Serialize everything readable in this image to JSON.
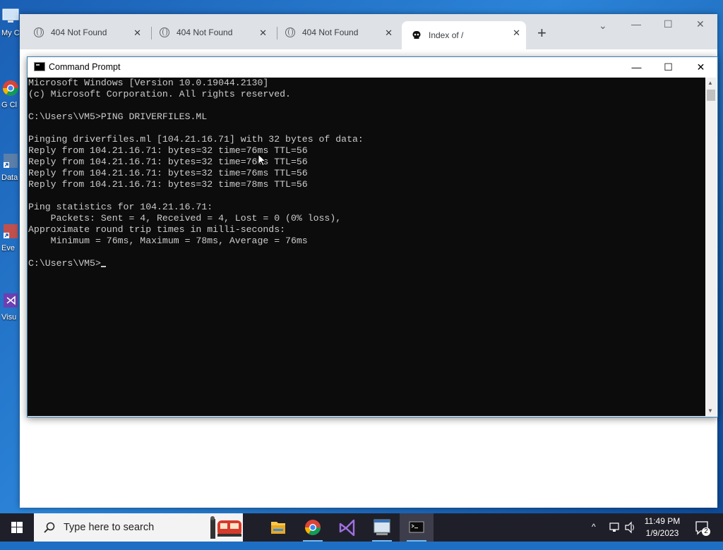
{
  "desktop": {
    "icons": [
      {
        "label": "My C"
      },
      {
        "label": "G Cl"
      },
      {
        "label": "Data"
      },
      {
        "label": "Eve"
      },
      {
        "label": "Visu"
      }
    ]
  },
  "browser": {
    "tabs": [
      {
        "title": "404 Not Found"
      },
      {
        "title": "404 Not Found"
      },
      {
        "title": "404 Not Found"
      },
      {
        "title": "Index of /"
      }
    ],
    "close_glyph": "✕",
    "new_tab_glyph": "+"
  },
  "cmd": {
    "title": "Command Prompt",
    "minimize_glyph": "—",
    "maximize_glyph": "☐",
    "close_glyph": "✕",
    "lines": [
      "Microsoft Windows [Version 10.0.19044.2130]",
      "(c) Microsoft Corporation. All rights reserved.",
      "",
      "C:\\Users\\VM5>PING DRIVERFILES.ML",
      "",
      "Pinging driverfiles.ml [104.21.16.71] with 32 bytes of data:",
      "Reply from 104.21.16.71: bytes=32 time=76ms TTL=56",
      "Reply from 104.21.16.71: bytes=32 time=76ms TTL=56",
      "Reply from 104.21.16.71: bytes=32 time=76ms TTL=56",
      "Reply from 104.21.16.71: bytes=32 time=78ms TTL=56",
      "",
      "Ping statistics for 104.21.16.71:",
      "    Packets: Sent = 4, Received = 4, Lost = 0 (0% loss),",
      "Approximate round trip times in milli-seconds:",
      "    Minimum = 76ms, Maximum = 78ms, Average = 76ms",
      ""
    ],
    "prompt": "C:\\Users\\VM5>"
  },
  "taskbar": {
    "search_placeholder": "Type here to search",
    "time": "11:49 PM",
    "date": "1/9/2023",
    "notification_count": "2"
  },
  "colors": {
    "console_bg": "#0c0c0c",
    "console_fg": "#cccccc",
    "taskbar_bg": "#1f1f2a"
  }
}
